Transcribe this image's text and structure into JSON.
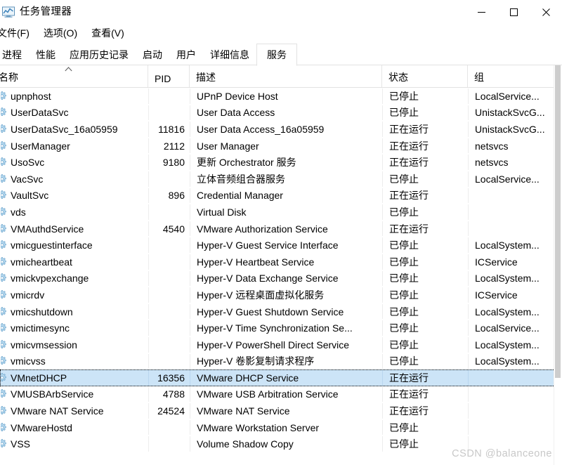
{
  "window": {
    "title": "任务管理器",
    "icon": "task-manager-chart-icon",
    "controls": {
      "minimize": "最小化",
      "maximize": "最大化",
      "close": "关闭"
    }
  },
  "menu": {
    "items": [
      {
        "label": "文件(F)",
        "name": "menu-file"
      },
      {
        "label": "选项(O)",
        "name": "menu-options"
      },
      {
        "label": "查看(V)",
        "name": "menu-view"
      }
    ]
  },
  "tabs": {
    "active": "服务",
    "items": [
      {
        "label": "进程",
        "name": "tab-processes",
        "active": false
      },
      {
        "label": "性能",
        "name": "tab-performance",
        "active": false
      },
      {
        "label": "应用历史记录",
        "name": "tab-app-history",
        "active": false
      },
      {
        "label": "启动",
        "name": "tab-startup",
        "active": false
      },
      {
        "label": "用户",
        "name": "tab-users",
        "active": false
      },
      {
        "label": "详细信息",
        "name": "tab-details",
        "active": false
      },
      {
        "label": "服务",
        "name": "tab-services",
        "active": true
      }
    ]
  },
  "table": {
    "sort": {
      "column": "名称",
      "direction": "ascending"
    },
    "columns": [
      {
        "key": "name",
        "label": "名称"
      },
      {
        "key": "pid",
        "label": "PID"
      },
      {
        "key": "description",
        "label": "描述"
      },
      {
        "key": "status",
        "label": "状态"
      },
      {
        "key": "group",
        "label": "组"
      }
    ],
    "status_values": {
      "stopped": "已停止",
      "running": "正在运行"
    },
    "rows": [
      {
        "name": "upnphost",
        "pid": "",
        "description": "UPnP Device Host",
        "status": "已停止",
        "group": "LocalService...",
        "selected": false
      },
      {
        "name": "UserDataSvc",
        "pid": "",
        "description": "User Data Access",
        "status": "已停止",
        "group": "UnistackSvcG...",
        "selected": false
      },
      {
        "name": "UserDataSvc_16a05959",
        "pid": "11816",
        "description": "User Data Access_16a05959",
        "status": "正在运行",
        "group": "UnistackSvcG...",
        "selected": false
      },
      {
        "name": "UserManager",
        "pid": "2112",
        "description": "User Manager",
        "status": "正在运行",
        "group": "netsvcs",
        "selected": false
      },
      {
        "name": "UsoSvc",
        "pid": "9180",
        "description": "更新 Orchestrator 服务",
        "status": "正在运行",
        "group": "netsvcs",
        "selected": false
      },
      {
        "name": "VacSvc",
        "pid": "",
        "description": "立体音频组合器服务",
        "status": "已停止",
        "group": "LocalService...",
        "selected": false
      },
      {
        "name": "VaultSvc",
        "pid": "896",
        "description": "Credential Manager",
        "status": "正在运行",
        "group": "",
        "selected": false
      },
      {
        "name": "vds",
        "pid": "",
        "description": "Virtual Disk",
        "status": "已停止",
        "group": "",
        "selected": false
      },
      {
        "name": "VMAuthdService",
        "pid": "4540",
        "description": "VMware Authorization Service",
        "status": "正在运行",
        "group": "",
        "selected": false
      },
      {
        "name": "vmicguestinterface",
        "pid": "",
        "description": "Hyper-V Guest Service Interface",
        "status": "已停止",
        "group": "LocalSystem...",
        "selected": false
      },
      {
        "name": "vmicheartbeat",
        "pid": "",
        "description": "Hyper-V Heartbeat Service",
        "status": "已停止",
        "group": "ICService",
        "selected": false
      },
      {
        "name": "vmickvpexchange",
        "pid": "",
        "description": "Hyper-V Data Exchange Service",
        "status": "已停止",
        "group": "LocalSystem...",
        "selected": false
      },
      {
        "name": "vmicrdv",
        "pid": "",
        "description": "Hyper-V 远程桌面虚拟化服务",
        "status": "已停止",
        "group": "ICService",
        "selected": false
      },
      {
        "name": "vmicshutdown",
        "pid": "",
        "description": "Hyper-V Guest Shutdown Service",
        "status": "已停止",
        "group": "LocalSystem...",
        "selected": false
      },
      {
        "name": "vmictimesync",
        "pid": "",
        "description": "Hyper-V Time Synchronization Se...",
        "status": "已停止",
        "group": "LocalService...",
        "selected": false
      },
      {
        "name": "vmicvmsession",
        "pid": "",
        "description": "Hyper-V PowerShell Direct Service",
        "status": "已停止",
        "group": "LocalSystem...",
        "selected": false
      },
      {
        "name": "vmicvss",
        "pid": "",
        "description": "Hyper-V 卷影复制请求程序",
        "status": "已停止",
        "group": "LocalSystem...",
        "selected": false
      },
      {
        "name": "VMnetDHCP",
        "pid": "16356",
        "description": "VMware DHCP Service",
        "status": "正在运行",
        "group": "",
        "selected": true
      },
      {
        "name": "VMUSBArbService",
        "pid": "4788",
        "description": "VMware USB Arbitration Service",
        "status": "正在运行",
        "group": "",
        "selected": false
      },
      {
        "name": "VMware NAT Service",
        "pid": "24524",
        "description": "VMware NAT Service",
        "status": "正在运行",
        "group": "",
        "selected": false
      },
      {
        "name": "VMwareHostd",
        "pid": "",
        "description": "VMware Workstation Server",
        "status": "已停止",
        "group": "",
        "selected": false
      },
      {
        "name": "VSS",
        "pid": "",
        "description": "Volume Shadow Copy",
        "status": "已停止",
        "group": "",
        "selected": false
      }
    ]
  },
  "watermark": {
    "text": "CSDN @balanceone"
  },
  "colors": {
    "selection": "#cce4f7",
    "header_border": "#e2e2e2",
    "grid_line": "#ededed",
    "watermark": "#c8c8c8",
    "icon_blue": "#7fb8dd"
  }
}
